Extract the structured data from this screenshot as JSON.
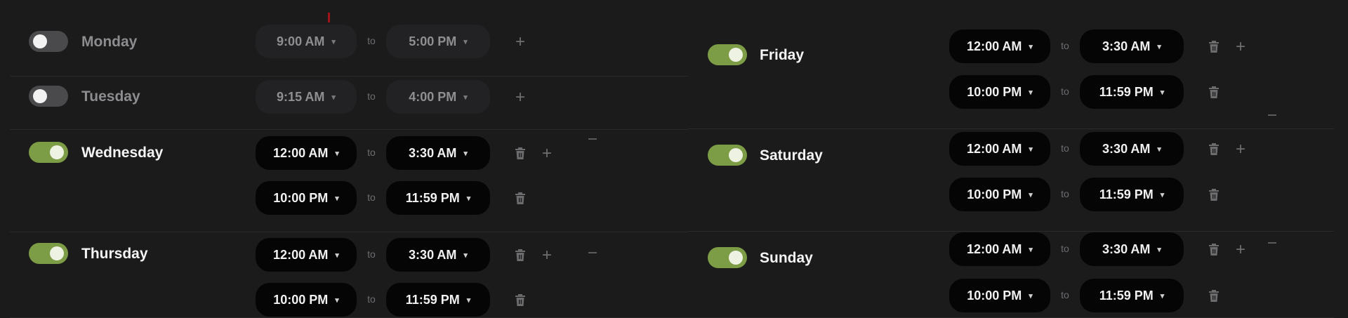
{
  "days": [
    {
      "name": "Monday",
      "enabled": false,
      "slots": [
        {
          "start": "9:00 AM",
          "end": "5:00 PM",
          "deletable": false,
          "addable": true
        }
      ]
    },
    {
      "name": "Tuesday",
      "enabled": false,
      "slots": [
        {
          "start": "9:15 AM",
          "end": "4:00 PM",
          "deletable": false,
          "addable": true
        }
      ]
    },
    {
      "name": "Wednesday",
      "enabled": true,
      "slots": [
        {
          "start": "12:00 AM",
          "end": "3:30 AM",
          "deletable": true,
          "addable": true
        },
        {
          "start": "10:00 PM",
          "end": "11:59 PM",
          "deletable": true,
          "addable": false
        }
      ]
    },
    {
      "name": "Thursday",
      "enabled": true,
      "slots": [
        {
          "start": "12:00 AM",
          "end": "3:30 AM",
          "deletable": true,
          "addable": true
        },
        {
          "start": "10:00 PM",
          "end": "11:59 PM",
          "deletable": true,
          "addable": false
        }
      ]
    },
    {
      "name": "Friday",
      "enabled": true,
      "slots": [
        {
          "start": "12:00 AM",
          "end": "3:30 AM",
          "deletable": true,
          "addable": true
        },
        {
          "start": "10:00 PM",
          "end": "11:59 PM",
          "deletable": true,
          "addable": false
        }
      ]
    },
    {
      "name": "Saturday",
      "enabled": true,
      "slots": [
        {
          "start": "12:00 AM",
          "end": "3:30 AM",
          "deletable": true,
          "addable": true
        },
        {
          "start": "10:00 PM",
          "end": "11:59 PM",
          "deletable": true,
          "addable": false
        }
      ]
    },
    {
      "name": "Sunday",
      "enabled": true,
      "slots": [
        {
          "start": "12:00 AM",
          "end": "3:30 AM",
          "deletable": true,
          "addable": true
        },
        {
          "start": "10:00 PM",
          "end": "11:59 PM",
          "deletable": true,
          "addable": false
        }
      ]
    }
  ],
  "separator_text": "to",
  "icons": {
    "chevron": "chevron-down-icon",
    "trash": "trash-icon",
    "plus": "plus-icon"
  },
  "colors": {
    "background": "#1b1b1c",
    "toggle_on": "#7d9c46",
    "toggle_off": "#4a4a4c",
    "pill": "#050506",
    "pill_disabled": "#222224"
  }
}
